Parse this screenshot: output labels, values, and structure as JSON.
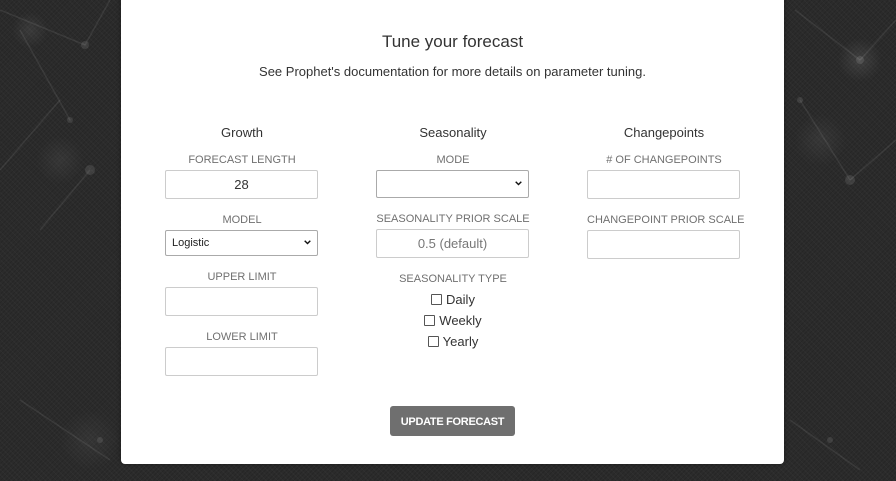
{
  "colors": {
    "page_background": "#2b2b2b",
    "card_background": "#ffffff",
    "heading_text": "#333333",
    "label_text": "#707070",
    "button_background": "#6f6f6f",
    "button_text": "#ffffff"
  },
  "form": {
    "title": "Tune your forecast",
    "subtitle": "See Prophet's documentation for more details on parameter tuning.",
    "growth": {
      "heading": "Growth",
      "forecast_length_label": "FORECAST LENGTH",
      "forecast_length_value": "28",
      "model_label": "MODEL",
      "model_selected": "Logistic",
      "upper_limit_label": "UPPER LIMIT",
      "upper_limit_value": "",
      "lower_limit_label": "LOWER LIMIT",
      "lower_limit_value": ""
    },
    "seasonality": {
      "heading": "Seasonality",
      "mode_label": "MODE",
      "mode_selected": "",
      "prior_scale_label": "SEASONALITY PRIOR SCALE",
      "prior_scale_placeholder": "0.5 (default)",
      "type_label": "SEASONALITY TYPE",
      "types": [
        {
          "label": "Daily",
          "checked": false
        },
        {
          "label": "Weekly",
          "checked": false
        },
        {
          "label": "Yearly",
          "checked": false
        }
      ]
    },
    "changepoints": {
      "heading": "Changepoints",
      "count_label": "# OF CHANGEPOINTS",
      "count_value": "",
      "prior_scale_label": "CHANGEPOINT PRIOR SCALE",
      "prior_scale_value": ""
    },
    "submit_label": "UPDATE FORECAST"
  },
  "icons": {
    "select_chevron": "chevron-down-icon",
    "checkbox": "checkbox-unchecked-icon"
  }
}
